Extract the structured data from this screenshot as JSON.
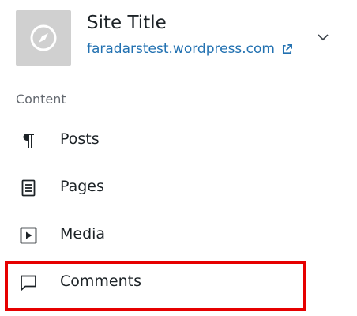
{
  "site": {
    "title": "Site Title",
    "url": "faradarstest.wordpress.com",
    "icon": "compass-icon",
    "external_icon": "external-link-icon",
    "expand_icon": "chevron-down-icon"
  },
  "content_section": {
    "label": "Content",
    "items": [
      {
        "label": "Posts",
        "icon": "pilcrow-icon"
      },
      {
        "label": "Pages",
        "icon": "page-icon"
      },
      {
        "label": "Media",
        "icon": "media-icon"
      },
      {
        "label": "Comments",
        "icon": "comment-icon"
      }
    ]
  },
  "colors": {
    "link": "#2271b1",
    "text": "#1d2327",
    "muted": "#646970",
    "highlight": "#e60000"
  }
}
